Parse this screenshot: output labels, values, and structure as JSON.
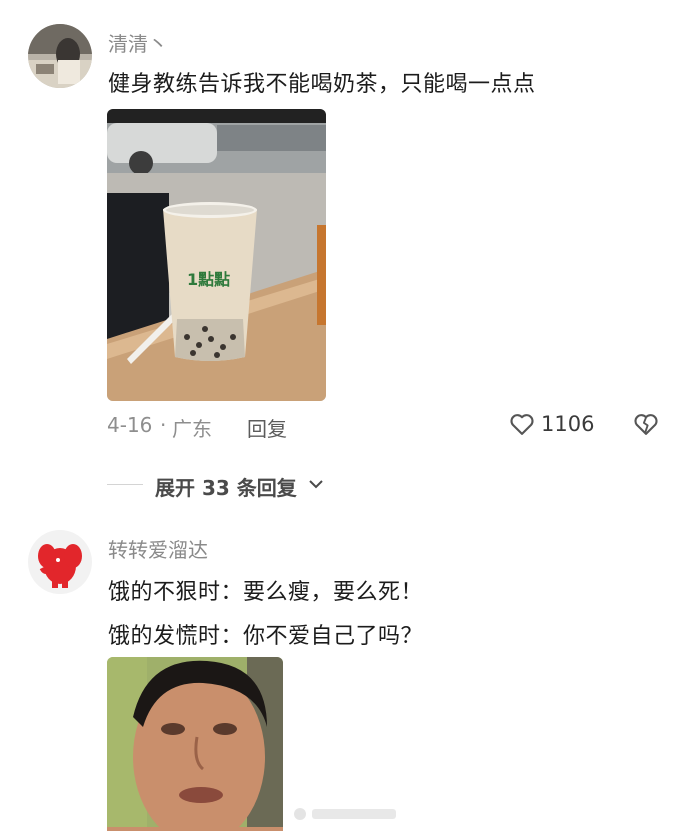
{
  "comment1": {
    "username": "清清丶",
    "text": "健身教练告诉我不能喝奶茶，只能喝一点点",
    "date": "4-16",
    "separator": "·",
    "location": "广东",
    "reply_label": "回复",
    "like_count": "1106",
    "cup_brand": "1點點",
    "photo_desc_icon": "milk-tea-photo"
  },
  "replies": {
    "expand_label": "展开 33 条回复"
  },
  "comment2": {
    "username": "转转爱溜达",
    "line1": "饿的不狠时：要么瘦，要么死！",
    "line2": "饿的发慌时：你不爱自己了吗？"
  },
  "colors": {
    "background": "#ffffff",
    "username": "#8a8a8a",
    "text": "#1c1c1c"
  }
}
